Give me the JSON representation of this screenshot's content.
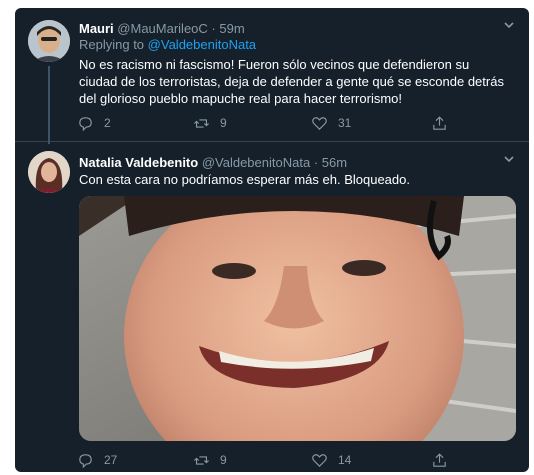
{
  "tweets": [
    {
      "name": "Mauri",
      "handle": "@MauMarileoC",
      "dot": "·",
      "time": "59m",
      "replying_prefix": "Replying to",
      "replying_to": "@ValdebenitoNata",
      "text": "No es racismo ni fascismo! Fueron sólo vecinos que defendieron su ciudad de los terroristas, deja de defender a gente qué se esconde detrás del glorioso pueblo mapuche real para hacer terrorismo!",
      "replies": "2",
      "retweets": "9",
      "likes": "31"
    },
    {
      "name": "Natalia Valdebenito",
      "handle": "@ValdebenitoNata",
      "dot": "·",
      "time": "56m",
      "text": "Con esta cara no podríamos esperar más eh. Bloqueado.",
      "replies": "27",
      "retweets": "9",
      "likes": "14"
    }
  ],
  "colors": {
    "background": "#15202b",
    "accent": "#1da1f2",
    "muted": "#8899a6",
    "divider": "#38444d"
  },
  "icons": [
    "chevron-down-icon",
    "reply-icon",
    "retweet-icon",
    "like-icon",
    "share-icon"
  ]
}
